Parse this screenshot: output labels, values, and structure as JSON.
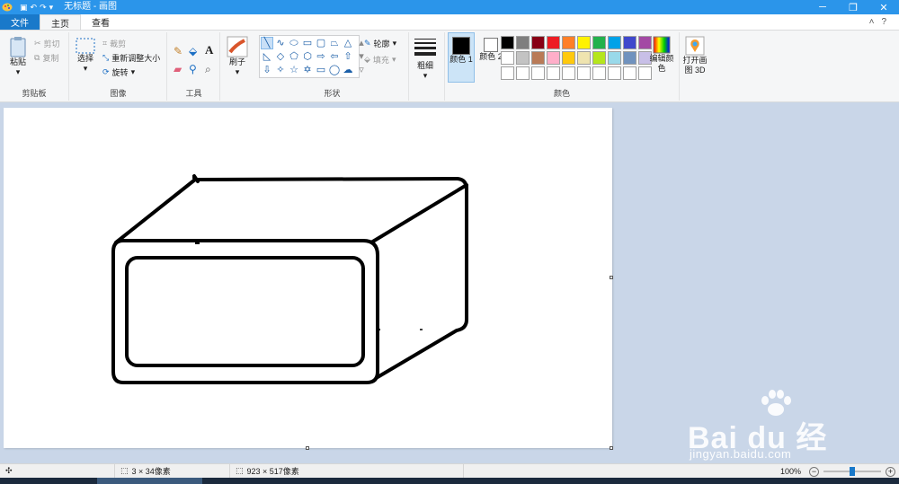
{
  "window": {
    "title": "无标题 - 画图",
    "controls": [
      "minimize-icon",
      "restore-icon",
      "close-icon"
    ]
  },
  "tabs": [
    {
      "label": "文件"
    },
    {
      "label": "主页"
    },
    {
      "label": "查看"
    }
  ],
  "ribbon": {
    "clipboard": {
      "paste": "粘贴",
      "cut": "剪切",
      "copy": "复制",
      "group": "剪贴板"
    },
    "image": {
      "select": "选择",
      "crop": "裁剪",
      "resize": "重新调整大小",
      "rotate": "旋转",
      "group": "图像"
    },
    "tools": {
      "group": "工具"
    },
    "brushes": {
      "label": "刷子"
    },
    "shapes": {
      "outline": "轮廓",
      "fill": "填充",
      "group": "形状"
    },
    "size": {
      "label": "粗细"
    },
    "colors": {
      "color1": "颜色 1",
      "color2": "颜色 2",
      "edit": "编辑颜色",
      "group": "颜色",
      "color1_value": "#000000",
      "color2_value": "#ffffff",
      "palette": [
        "#000000",
        "#7f7f7f",
        "#880015",
        "#ed1c24",
        "#ff7f27",
        "#fff200",
        "#22b14c",
        "#00a2e8",
        "#3f48cc",
        "#a349a4",
        "#ffffff",
        "#c3c3c3",
        "#b97a57",
        "#ffaec9",
        "#ffc90e",
        "#efe4b0",
        "#b5e61d",
        "#99d9ea",
        "#7092be",
        "#c8bfe7",
        "#ffffff",
        "#ffffff",
        "#ffffff",
        "#ffffff",
        "#ffffff",
        "#ffffff",
        "#ffffff",
        "#ffffff",
        "#ffffff",
        "#ffffff"
      ]
    },
    "paint3d": {
      "label": "打开画图 3D"
    }
  },
  "status": {
    "selection_size": "3 × 34像素",
    "image_size": "923 × 517像素",
    "zoom": "100%",
    "zoom_level": 1.0
  },
  "watermark": {
    "brand": "Bai du 经验",
    "url": "jingyan.baidu.com"
  }
}
